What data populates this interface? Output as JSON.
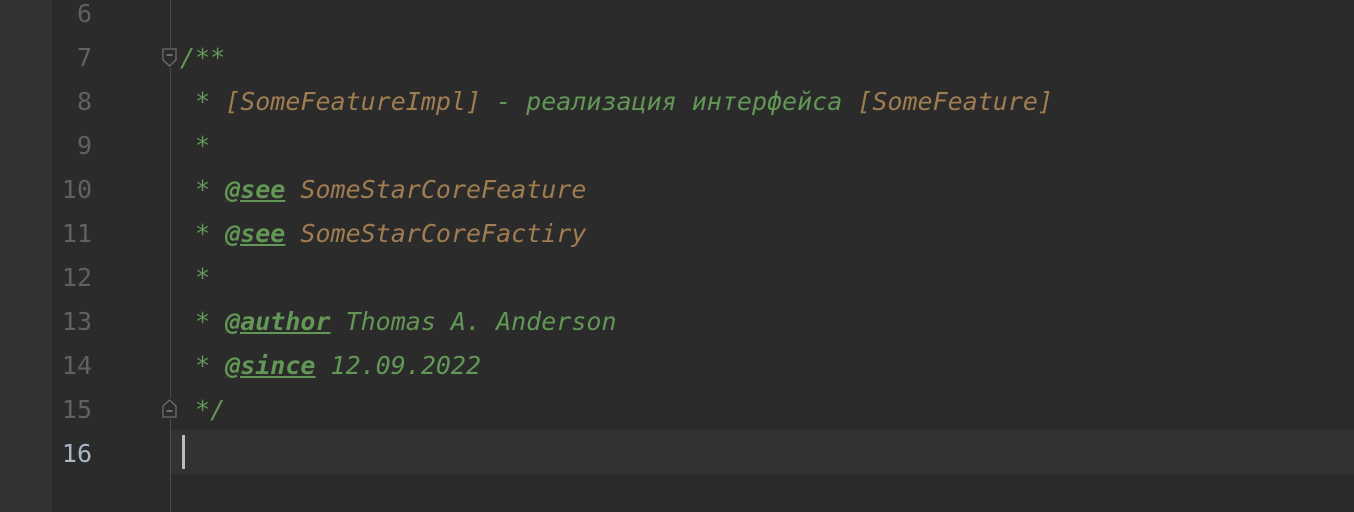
{
  "colors": {
    "background": "#2b2b2b",
    "gutter_strip": "#313335",
    "line_number": "#5f6163",
    "line_number_current": "#a9b7c6",
    "doc_comment": "#629755",
    "doc_reference": "#a07d51",
    "current_line": "#323232"
  },
  "icons": {
    "fold_start": "fold-start-icon",
    "fold_end": "fold-end-icon"
  },
  "editor": {
    "current_line": "16",
    "lines": [
      {
        "number": "6"
      },
      {
        "number": "7",
        "text": "/**"
      },
      {
        "number": "8",
        "prefix": " * ",
        "ref1": "[SomeFeatureImpl]",
        "mid": " - реализация интерфейса ",
        "ref2": "[SomeFeature]"
      },
      {
        "number": "9",
        "prefix": " *"
      },
      {
        "number": "10",
        "prefix": " * ",
        "tag": "@see",
        "ref": " SomeStarCoreFeature"
      },
      {
        "number": "11",
        "prefix": " * ",
        "tag": "@see",
        "ref": " SomeStarCoreFactiry"
      },
      {
        "number": "12",
        "prefix": " *"
      },
      {
        "number": "13",
        "prefix": " * ",
        "tag": "@author",
        "value": " Thomas A. Anderson"
      },
      {
        "number": "14",
        "prefix": " * ",
        "tag": "@since",
        "value": " 12.09.2022"
      },
      {
        "number": "15",
        "text": " */"
      },
      {
        "number": "16"
      }
    ]
  }
}
